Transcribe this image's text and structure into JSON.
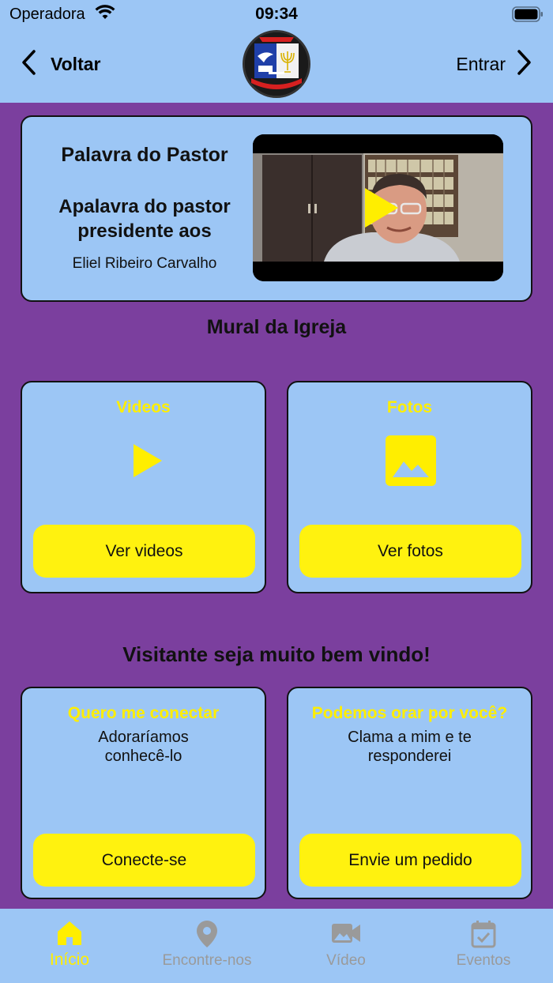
{
  "status": {
    "carrier": "Operadora",
    "time": "09:34"
  },
  "nav": {
    "back_label": "Voltar",
    "login_label": "Entrar"
  },
  "pastor": {
    "title": "Palavra do Pastor",
    "subtitle": "Apalavra do pastor presidente aos",
    "name": "Eliel Ribeiro Carvalho"
  },
  "mural": {
    "title": "Mural da Igreja",
    "videos": {
      "title": "Videos",
      "button": "Ver videos"
    },
    "photos": {
      "title": "Fotos",
      "button": "Ver fotos"
    }
  },
  "welcome": {
    "title": "Visitante seja muito bem vindo!",
    "connect": {
      "title": "Quero me conectar",
      "text": "Adoraríamos conhecê-lo",
      "button": "Conecte-se"
    },
    "pray": {
      "title": "Podemos orar por você?",
      "text": "Clama a mim e te responderei",
      "button": "Envie um pedido"
    }
  },
  "tabs": [
    {
      "label": "Início",
      "icon": "home-icon",
      "active": true
    },
    {
      "label": "Encontre-nos",
      "icon": "location-pin-icon",
      "active": false
    },
    {
      "label": "Vídeo",
      "icon": "video-camera-icon",
      "active": false
    },
    {
      "label": "Eventos",
      "icon": "calendar-check-icon",
      "active": false
    }
  ],
  "colors": {
    "background": "#7B3F9E",
    "card": "#9CC6F5",
    "accent": "#FFEE00",
    "button": "#FFF20F",
    "inactive_tab": "#9A9A9A"
  }
}
